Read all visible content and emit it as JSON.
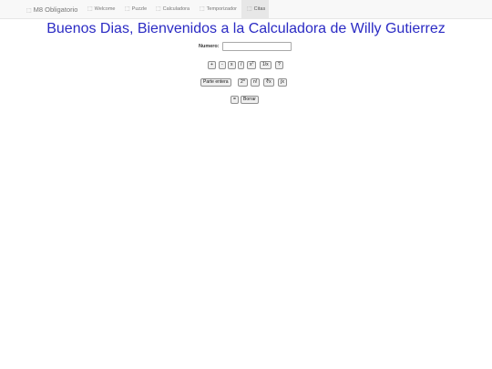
{
  "navbar": {
    "brand_icon": "⬚",
    "brand_label": "M8 Obligatorio",
    "items": [
      {
        "icon": "⬚",
        "label": "Welcome",
        "active": false
      },
      {
        "icon": "⬚",
        "label": "Puzzle",
        "active": false
      },
      {
        "icon": "⬚",
        "label": "Calculadora",
        "active": false
      },
      {
        "icon": "⬚",
        "label": "Temporizador",
        "active": false
      },
      {
        "icon": "⬚",
        "label": "Citas",
        "active": true
      }
    ]
  },
  "main": {
    "title": "Buenos Dias, Bienvenidos a la Calculadora de Willy Gutierrez",
    "number_label": "Numero:",
    "number_value": "",
    "ops_row1": [
      "+",
      "-",
      "x",
      "/",
      "x",
      "1/x",
      "?"
    ],
    "ops_row1_square_sup": "2",
    "ops_row2": [
      "Parte entera",
      "2^",
      "n!",
      "∛x",
      "∫x"
    ],
    "ops_row3": [
      "=",
      "Borrar"
    ]
  },
  "colors": {
    "title": "#2b2bc4",
    "navbar_bg": "#f8f8f8",
    "nav_active_bg": "#e7e7e7"
  }
}
